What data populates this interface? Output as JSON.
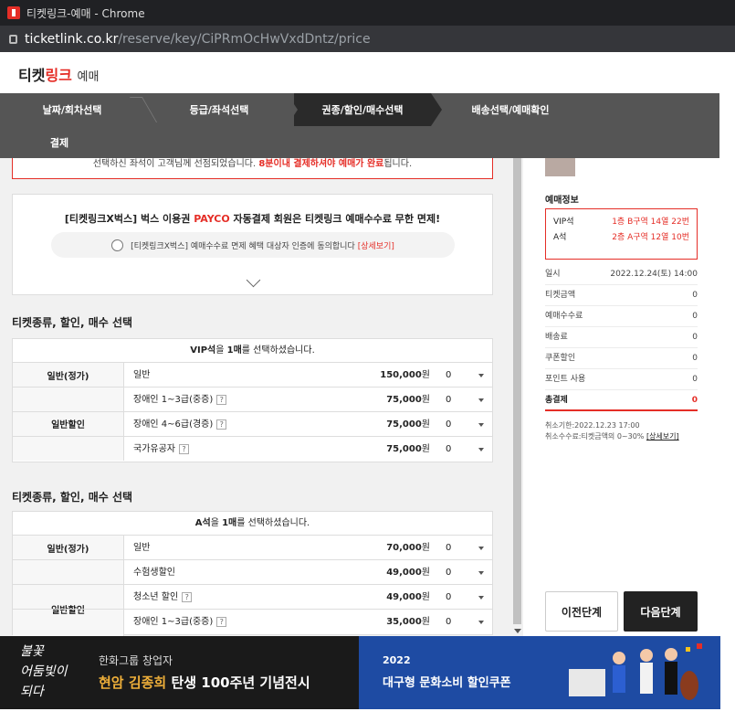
{
  "browser": {
    "tab_title": "티켓링크-예매 - Chrome",
    "url_domain": "ticketlink.co.kr",
    "url_path": "/reserve/key/CiPRmOcHwVxdDntz/price"
  },
  "logo": {
    "brand_main": "티켓",
    "brand_red": "링크",
    "brand_sub": "예매"
  },
  "steps": [
    {
      "label": "날짜/회차선택",
      "active": false
    },
    {
      "label": "등급/좌석선택",
      "active": false
    },
    {
      "label": "권종/할인/매수선택",
      "active": true
    },
    {
      "label": "배송선택/예매확인",
      "active": false
    },
    {
      "label": "결제",
      "active": false
    }
  ],
  "notice": {
    "text_pre": "선택하신 좌석이 고객님께 선점되었습니다. ",
    "text_highlight": "8분이내 결제하셔야 예매가 완료",
    "text_post": "됩니다."
  },
  "payco": {
    "title_pre": "[티켓링크X벅스] 벅스 이용권 ",
    "title_highlight": "PAYCO",
    "title_post": " 자동결제 회원은 티켓링크 예매수수료 무한 면제!",
    "consent_text": "[티켓링크X벅스] 예매수수료 면제 혜택 대상자 인증에 동의합니다",
    "consent_link": "[상세보기]"
  },
  "sections": [
    {
      "title": "티켓종류, 할인, 매수 선택",
      "header_seat": "VIP석",
      "header_mid": "을 ",
      "header_count": "1매",
      "header_post": "를 선택하셨습니다.",
      "groups": [
        {
          "category": "일반(정가)",
          "rows": [
            {
              "name": "일반",
              "help": false,
              "price": "150,000",
              "unit": "원",
              "qty": "0"
            }
          ]
        },
        {
          "category": "일반할인",
          "rows": [
            {
              "name": "장애인 1~3급(중증)",
              "help": true,
              "price": "75,000",
              "unit": "원",
              "qty": "0"
            },
            {
              "name": "장애인 4~6급(경증)",
              "help": true,
              "price": "75,000",
              "unit": "원",
              "qty": "0"
            },
            {
              "name": "국가유공자",
              "help": true,
              "price": "75,000",
              "unit": "원",
              "qty": "0"
            }
          ]
        }
      ]
    },
    {
      "title": "티켓종류, 할인, 매수 선택",
      "header_seat": "A석",
      "header_mid": "을 ",
      "header_count": "1매",
      "header_post": "를 선택하셨습니다.",
      "groups": [
        {
          "category": "일반(정가)",
          "rows": [
            {
              "name": "일반",
              "help": false,
              "price": "70,000",
              "unit": "원",
              "qty": "0"
            }
          ]
        },
        {
          "category": "일반할인",
          "rows": [
            {
              "name": "수험생할인",
              "help": false,
              "price": "49,000",
              "unit": "원",
              "qty": "0"
            },
            {
              "name": "청소년 할인",
              "help": true,
              "price": "49,000",
              "unit": "원",
              "qty": "0"
            },
            {
              "name": "장애인 1~3급(중증)",
              "help": true,
              "price": "35,000",
              "unit": "원",
              "qty": "0"
            }
          ]
        }
      ]
    }
  ],
  "help_icon": "?",
  "sidebar": {
    "title": "예매정보",
    "seats": [
      {
        "grade": "VIP석",
        "position": "1층 B구역 14열 22번"
      },
      {
        "grade": "A석",
        "position": "2층 A구역 12열 10번"
      }
    ],
    "info": [
      {
        "label": "일시",
        "value": "2022.12.24(토) 14:00"
      },
      {
        "label": "티켓금액",
        "value": "0"
      },
      {
        "label": "예매수수료",
        "value": "0"
      },
      {
        "label": "배송료",
        "value": "0"
      },
      {
        "label": "쿠폰할인",
        "value": "0"
      },
      {
        "label": "포인트 사용",
        "value": "0"
      }
    ],
    "total_label": "총결제",
    "total_value": "0",
    "cancel_deadline": "취소기한:2022.12.23 17:00",
    "cancel_fee": "취소수수료:티켓금액의 0~30% ",
    "cancel_fee_link": "[상세보기]",
    "prev_label": "이전단계",
    "next_label": "다음단계"
  },
  "banners": {
    "left": {
      "art_line1": "불꽃",
      "art_line2": "어둠빛이",
      "art_line3": "되다",
      "line1": "한화그룹 창업자",
      "line2_gold": "현암 김종희",
      "line2_rest": " 탄생 100주년 기념전시"
    },
    "right": {
      "year": "2022",
      "title": "대구형 문화소비 할인쿠폰"
    }
  },
  "colors": {
    "accent": "#e52e27",
    "step_bar": "#555555",
    "step_active": "#2a2a2a"
  }
}
